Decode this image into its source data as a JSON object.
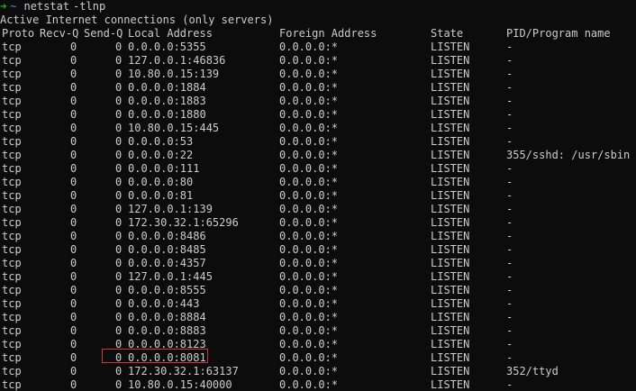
{
  "prompt": {
    "arrow": "➜",
    "cwd": "~",
    "command": "netstat",
    "args": "-tlnp"
  },
  "banner": "Active Internet connections (only servers)",
  "headers": {
    "proto": "Proto",
    "recv": "Recv-Q",
    "send": "Send-Q",
    "local": "Local Address",
    "foreign": "Foreign Address",
    "state": "State",
    "pid": "PID/Program name"
  },
  "rows": [
    {
      "proto": "tcp",
      "recv": "0",
      "send": "0",
      "local": "0.0.0.0:5355",
      "foreign": "0.0.0.0:*",
      "state": "LISTEN",
      "pid": "-"
    },
    {
      "proto": "tcp",
      "recv": "0",
      "send": "0",
      "local": "127.0.0.1:46836",
      "foreign": "0.0.0.0:*",
      "state": "LISTEN",
      "pid": "-"
    },
    {
      "proto": "tcp",
      "recv": "0",
      "send": "0",
      "local": "10.80.0.15:139",
      "foreign": "0.0.0.0:*",
      "state": "LISTEN",
      "pid": "-"
    },
    {
      "proto": "tcp",
      "recv": "0",
      "send": "0",
      "local": "0.0.0.0:1884",
      "foreign": "0.0.0.0:*",
      "state": "LISTEN",
      "pid": "-"
    },
    {
      "proto": "tcp",
      "recv": "0",
      "send": "0",
      "local": "0.0.0.0:1883",
      "foreign": "0.0.0.0:*",
      "state": "LISTEN",
      "pid": "-"
    },
    {
      "proto": "tcp",
      "recv": "0",
      "send": "0",
      "local": "0.0.0.0:1880",
      "foreign": "0.0.0.0:*",
      "state": "LISTEN",
      "pid": "-"
    },
    {
      "proto": "tcp",
      "recv": "0",
      "send": "0",
      "local": "10.80.0.15:445",
      "foreign": "0.0.0.0:*",
      "state": "LISTEN",
      "pid": "-"
    },
    {
      "proto": "tcp",
      "recv": "0",
      "send": "0",
      "local": "0.0.0.0:53",
      "foreign": "0.0.0.0:*",
      "state": "LISTEN",
      "pid": "-"
    },
    {
      "proto": "tcp",
      "recv": "0",
      "send": "0",
      "local": "0.0.0.0:22",
      "foreign": "0.0.0.0:*",
      "state": "LISTEN",
      "pid": "355/sshd: /usr/sbin"
    },
    {
      "proto": "tcp",
      "recv": "0",
      "send": "0",
      "local": "0.0.0.0:111",
      "foreign": "0.0.0.0:*",
      "state": "LISTEN",
      "pid": "-"
    },
    {
      "proto": "tcp",
      "recv": "0",
      "send": "0",
      "local": "0.0.0.0:80",
      "foreign": "0.0.0.0:*",
      "state": "LISTEN",
      "pid": "-"
    },
    {
      "proto": "tcp",
      "recv": "0",
      "send": "0",
      "local": "0.0.0.0:81",
      "foreign": "0.0.0.0:*",
      "state": "LISTEN",
      "pid": "-"
    },
    {
      "proto": "tcp",
      "recv": "0",
      "send": "0",
      "local": "127.0.0.1:139",
      "foreign": "0.0.0.0:*",
      "state": "LISTEN",
      "pid": "-"
    },
    {
      "proto": "tcp",
      "recv": "0",
      "send": "0",
      "local": "172.30.32.1:65296",
      "foreign": "0.0.0.0:*",
      "state": "LISTEN",
      "pid": "-"
    },
    {
      "proto": "tcp",
      "recv": "0",
      "send": "0",
      "local": "0.0.0.0:8486",
      "foreign": "0.0.0.0:*",
      "state": "LISTEN",
      "pid": "-"
    },
    {
      "proto": "tcp",
      "recv": "0",
      "send": "0",
      "local": "0.0.0.0:8485",
      "foreign": "0.0.0.0:*",
      "state": "LISTEN",
      "pid": "-"
    },
    {
      "proto": "tcp",
      "recv": "0",
      "send": "0",
      "local": "0.0.0.0:4357",
      "foreign": "0.0.0.0:*",
      "state": "LISTEN",
      "pid": "-"
    },
    {
      "proto": "tcp",
      "recv": "0",
      "send": "0",
      "local": "127.0.0.1:445",
      "foreign": "0.0.0.0:*",
      "state": "LISTEN",
      "pid": "-"
    },
    {
      "proto": "tcp",
      "recv": "0",
      "send": "0",
      "local": "0.0.0.0:8555",
      "foreign": "0.0.0.0:*",
      "state": "LISTEN",
      "pid": "-"
    },
    {
      "proto": "tcp",
      "recv": "0",
      "send": "0",
      "local": "0.0.0.0:443",
      "foreign": "0.0.0.0:*",
      "state": "LISTEN",
      "pid": "-"
    },
    {
      "proto": "tcp",
      "recv": "0",
      "send": "0",
      "local": "0.0.0.0:8884",
      "foreign": "0.0.0.0:*",
      "state": "LISTEN",
      "pid": "-"
    },
    {
      "proto": "tcp",
      "recv": "0",
      "send": "0",
      "local": "0.0.0.0:8883",
      "foreign": "0.0.0.0:*",
      "state": "LISTEN",
      "pid": "-"
    },
    {
      "proto": "tcp",
      "recv": "0",
      "send": "0",
      "local": "0.0.0.0:8123",
      "foreign": "0.0.0.0:*",
      "state": "LISTEN",
      "pid": "-"
    },
    {
      "proto": "tcp",
      "recv": "0",
      "send": "0",
      "local": "0.0.0.0:8081",
      "foreign": "0.0.0.0:*",
      "state": "LISTEN",
      "pid": "-"
    },
    {
      "proto": "tcp",
      "recv": "0",
      "send": "0",
      "local": "172.30.32.1:63137",
      "foreign": "0.0.0.0:*",
      "state": "LISTEN",
      "pid": "352/ttyd"
    },
    {
      "proto": "tcp",
      "recv": "0",
      "send": "0",
      "local": "10.80.0.15:40000",
      "foreign": "0.0.0.0:*",
      "state": "LISTEN",
      "pid": "-"
    }
  ],
  "colors": {
    "background": "#0c0c0c",
    "text": "#cccccc",
    "prompt_arrow": "#16c60c",
    "prompt_cwd": "#3a96dd",
    "highlight": "#d13438"
  }
}
